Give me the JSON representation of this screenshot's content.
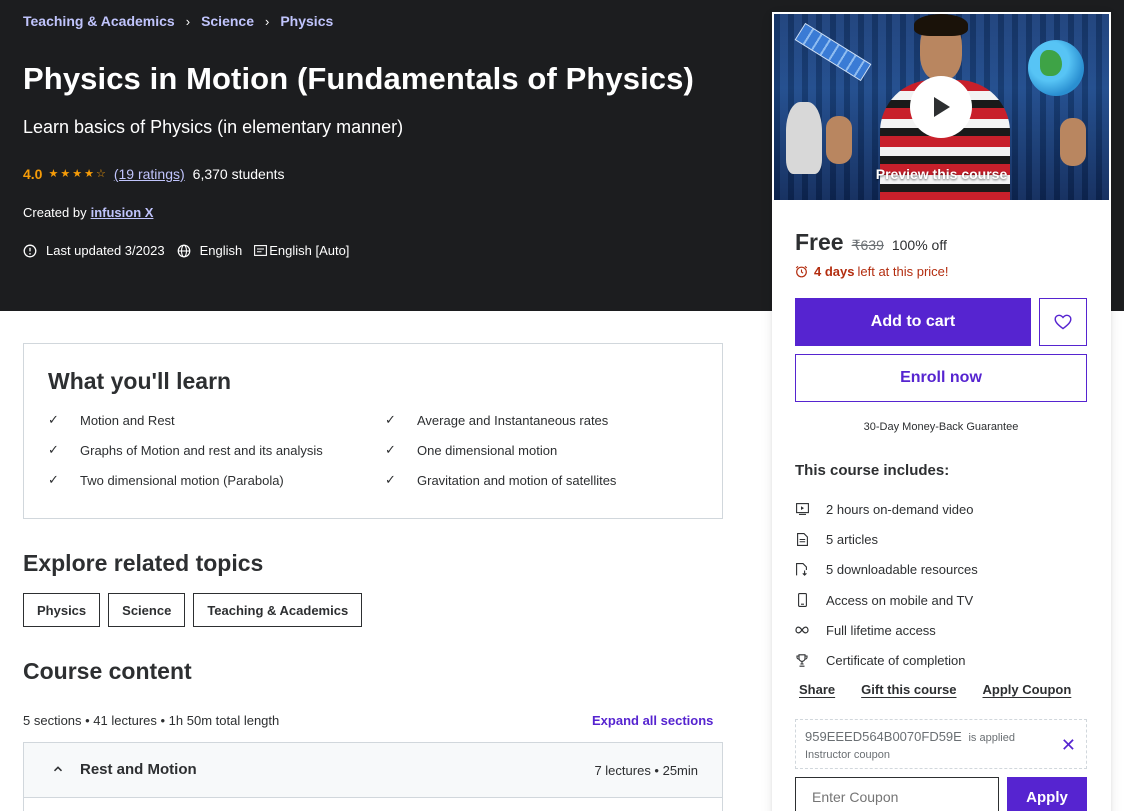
{
  "breadcrumb": [
    "Teaching & Academics",
    "Science",
    "Physics"
  ],
  "course": {
    "title": "Physics in Motion (Fundamentals of Physics)",
    "subtitle": "Learn basics of Physics (in elementary manner)",
    "rating": "4.0",
    "stars": 4,
    "ratings_link": "(19 ratings)",
    "students": "6,370 students",
    "created_by_label": "Created by",
    "instructor": "infusion X",
    "last_updated": "Last updated 3/2023",
    "language": "English",
    "captions": "English [Auto]"
  },
  "sidebar": {
    "preview_label": "Preview this course",
    "price_free": "Free",
    "price_original": "₹639",
    "discount": "100% off",
    "deadline_bold": "4 days",
    "deadline_rest": "left at this price!",
    "add_to_cart": "Add to cart",
    "enroll_now": "Enroll now",
    "guarantee": "30-Day Money-Back Guarantee",
    "includes_title": "This course includes:",
    "includes": [
      {
        "icon": "video-icon",
        "label": "2 hours on-demand video"
      },
      {
        "icon": "article-icon",
        "label": "5 articles"
      },
      {
        "icon": "download-icon",
        "label": "5 downloadable resources"
      },
      {
        "icon": "mobile-icon",
        "label": "Access on mobile and TV"
      },
      {
        "icon": "infinity-icon",
        "label": "Full lifetime access"
      },
      {
        "icon": "trophy-icon",
        "label": "Certificate of completion"
      }
    ],
    "links": {
      "share": "Share",
      "gift": "Gift this course",
      "apply_coupon": "Apply Coupon"
    },
    "coupon": {
      "code": "959EEED564B0070FD59E",
      "applied": "is applied",
      "type": "Instructor coupon",
      "input_placeholder": "Enter Coupon",
      "apply_button": "Apply"
    }
  },
  "learn": {
    "title": "What you'll learn",
    "items": [
      "Motion and Rest",
      "Average and Instantaneous rates",
      "Graphs of Motion and rest and its analysis",
      "One dimensional motion",
      "Two dimensional motion (Parabola)",
      "Gravitation and motion of satellites"
    ]
  },
  "related": {
    "title": "Explore related topics",
    "topics": [
      "Physics",
      "Science",
      "Teaching & Academics"
    ]
  },
  "content": {
    "title": "Course content",
    "meta": "5 sections • 41 lectures • 1h 50m total length",
    "expand_all": "Expand all sections",
    "sections": [
      {
        "name": "Rest and Motion",
        "info": "7 lectures • 25min"
      }
    ]
  },
  "colors": {
    "hero_bg": "#1c1d1f",
    "brand_purple": "#5624d0",
    "link_light": "#c0c4fc",
    "star": "#f69c08",
    "alert_red": "#b32d0f"
  }
}
